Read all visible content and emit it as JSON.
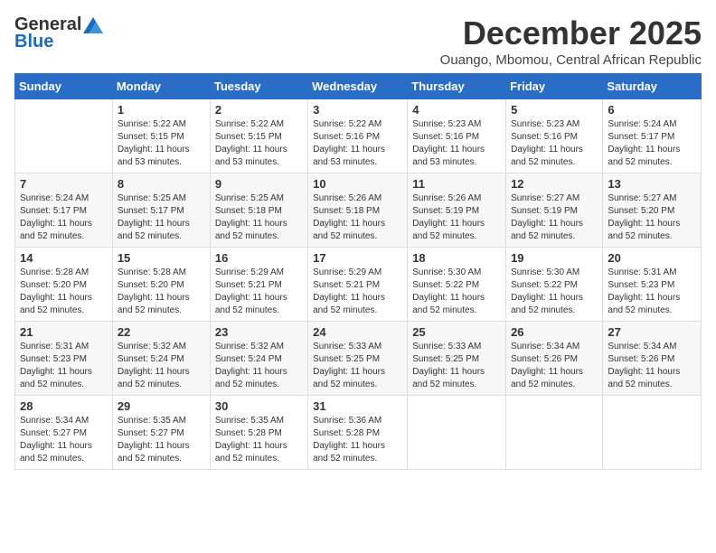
{
  "logo": {
    "general": "General",
    "blue": "Blue"
  },
  "title": {
    "month_year": "December 2025",
    "location": "Ouango, Mbomou, Central African Republic"
  },
  "weekdays": [
    "Sunday",
    "Monday",
    "Tuesday",
    "Wednesday",
    "Thursday",
    "Friday",
    "Saturday"
  ],
  "weeks": [
    [
      {
        "day": "",
        "sunrise": "",
        "sunset": "",
        "daylight": ""
      },
      {
        "day": "1",
        "sunrise": "5:22 AM",
        "sunset": "5:15 PM",
        "daylight": "11 hours and 53 minutes."
      },
      {
        "day": "2",
        "sunrise": "5:22 AM",
        "sunset": "5:15 PM",
        "daylight": "11 hours and 53 minutes."
      },
      {
        "day": "3",
        "sunrise": "5:22 AM",
        "sunset": "5:16 PM",
        "daylight": "11 hours and 53 minutes."
      },
      {
        "day": "4",
        "sunrise": "5:23 AM",
        "sunset": "5:16 PM",
        "daylight": "11 hours and 53 minutes."
      },
      {
        "day": "5",
        "sunrise": "5:23 AM",
        "sunset": "5:16 PM",
        "daylight": "11 hours and 52 minutes."
      },
      {
        "day": "6",
        "sunrise": "5:24 AM",
        "sunset": "5:17 PM",
        "daylight": "11 hours and 52 minutes."
      }
    ],
    [
      {
        "day": "7",
        "sunrise": "5:24 AM",
        "sunset": "5:17 PM",
        "daylight": "11 hours and 52 minutes."
      },
      {
        "day": "8",
        "sunrise": "5:25 AM",
        "sunset": "5:17 PM",
        "daylight": "11 hours and 52 minutes."
      },
      {
        "day": "9",
        "sunrise": "5:25 AM",
        "sunset": "5:18 PM",
        "daylight": "11 hours and 52 minutes."
      },
      {
        "day": "10",
        "sunrise": "5:26 AM",
        "sunset": "5:18 PM",
        "daylight": "11 hours and 52 minutes."
      },
      {
        "day": "11",
        "sunrise": "5:26 AM",
        "sunset": "5:19 PM",
        "daylight": "11 hours and 52 minutes."
      },
      {
        "day": "12",
        "sunrise": "5:27 AM",
        "sunset": "5:19 PM",
        "daylight": "11 hours and 52 minutes."
      },
      {
        "day": "13",
        "sunrise": "5:27 AM",
        "sunset": "5:20 PM",
        "daylight": "11 hours and 52 minutes."
      }
    ],
    [
      {
        "day": "14",
        "sunrise": "5:28 AM",
        "sunset": "5:20 PM",
        "daylight": "11 hours and 52 minutes."
      },
      {
        "day": "15",
        "sunrise": "5:28 AM",
        "sunset": "5:20 PM",
        "daylight": "11 hours and 52 minutes."
      },
      {
        "day": "16",
        "sunrise": "5:29 AM",
        "sunset": "5:21 PM",
        "daylight": "11 hours and 52 minutes."
      },
      {
        "day": "17",
        "sunrise": "5:29 AM",
        "sunset": "5:21 PM",
        "daylight": "11 hours and 52 minutes."
      },
      {
        "day": "18",
        "sunrise": "5:30 AM",
        "sunset": "5:22 PM",
        "daylight": "11 hours and 52 minutes."
      },
      {
        "day": "19",
        "sunrise": "5:30 AM",
        "sunset": "5:22 PM",
        "daylight": "11 hours and 52 minutes."
      },
      {
        "day": "20",
        "sunrise": "5:31 AM",
        "sunset": "5:23 PM",
        "daylight": "11 hours and 52 minutes."
      }
    ],
    [
      {
        "day": "21",
        "sunrise": "5:31 AM",
        "sunset": "5:23 PM",
        "daylight": "11 hours and 52 minutes."
      },
      {
        "day": "22",
        "sunrise": "5:32 AM",
        "sunset": "5:24 PM",
        "daylight": "11 hours and 52 minutes."
      },
      {
        "day": "23",
        "sunrise": "5:32 AM",
        "sunset": "5:24 PM",
        "daylight": "11 hours and 52 minutes."
      },
      {
        "day": "24",
        "sunrise": "5:33 AM",
        "sunset": "5:25 PM",
        "daylight": "11 hours and 52 minutes."
      },
      {
        "day": "25",
        "sunrise": "5:33 AM",
        "sunset": "5:25 PM",
        "daylight": "11 hours and 52 minutes."
      },
      {
        "day": "26",
        "sunrise": "5:34 AM",
        "sunset": "5:26 PM",
        "daylight": "11 hours and 52 minutes."
      },
      {
        "day": "27",
        "sunrise": "5:34 AM",
        "sunset": "5:26 PM",
        "daylight": "11 hours and 52 minutes."
      }
    ],
    [
      {
        "day": "28",
        "sunrise": "5:34 AM",
        "sunset": "5:27 PM",
        "daylight": "11 hours and 52 minutes."
      },
      {
        "day": "29",
        "sunrise": "5:35 AM",
        "sunset": "5:27 PM",
        "daylight": "11 hours and 52 minutes."
      },
      {
        "day": "30",
        "sunrise": "5:35 AM",
        "sunset": "5:28 PM",
        "daylight": "11 hours and 52 minutes."
      },
      {
        "day": "31",
        "sunrise": "5:36 AM",
        "sunset": "5:28 PM",
        "daylight": "11 hours and 52 minutes."
      },
      {
        "day": "",
        "sunrise": "",
        "sunset": "",
        "daylight": ""
      },
      {
        "day": "",
        "sunrise": "",
        "sunset": "",
        "daylight": ""
      },
      {
        "day": "",
        "sunrise": "",
        "sunset": "",
        "daylight": ""
      }
    ]
  ]
}
